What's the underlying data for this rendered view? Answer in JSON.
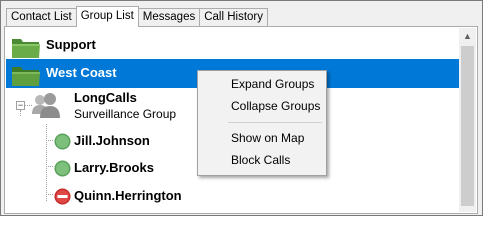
{
  "tabs": [
    {
      "label": "Contact List"
    },
    {
      "label": "Group List"
    },
    {
      "label": "Messages"
    },
    {
      "label": "Call History"
    }
  ],
  "active_tab": "Group List",
  "tree": {
    "groups": [
      {
        "name": "Support",
        "selected": false
      },
      {
        "name": "West Coast",
        "selected": true
      }
    ],
    "subgroup": {
      "name": "LongCalls",
      "subtitle": "Surveillance Group"
    },
    "contacts": [
      {
        "name": "Jill.Johnson",
        "status": "available",
        "icon": "green-status-icon"
      },
      {
        "name": "Larry.Brooks",
        "status": "available",
        "icon": "green-status-icon"
      },
      {
        "name": "Quinn.Herrington",
        "status": "do-not-disturb",
        "icon": "red-block-icon"
      }
    ]
  },
  "context_menu": {
    "items": [
      {
        "label": "Expand Groups"
      },
      {
        "label": "Collapse Groups"
      },
      {
        "label": "Show on Map"
      },
      {
        "label": "Block Calls"
      }
    ]
  },
  "colors": {
    "selection": "#0078d7",
    "folder_green": "#5a9a3c",
    "status_green": "#6bb36b",
    "status_red": "#cc3333"
  }
}
